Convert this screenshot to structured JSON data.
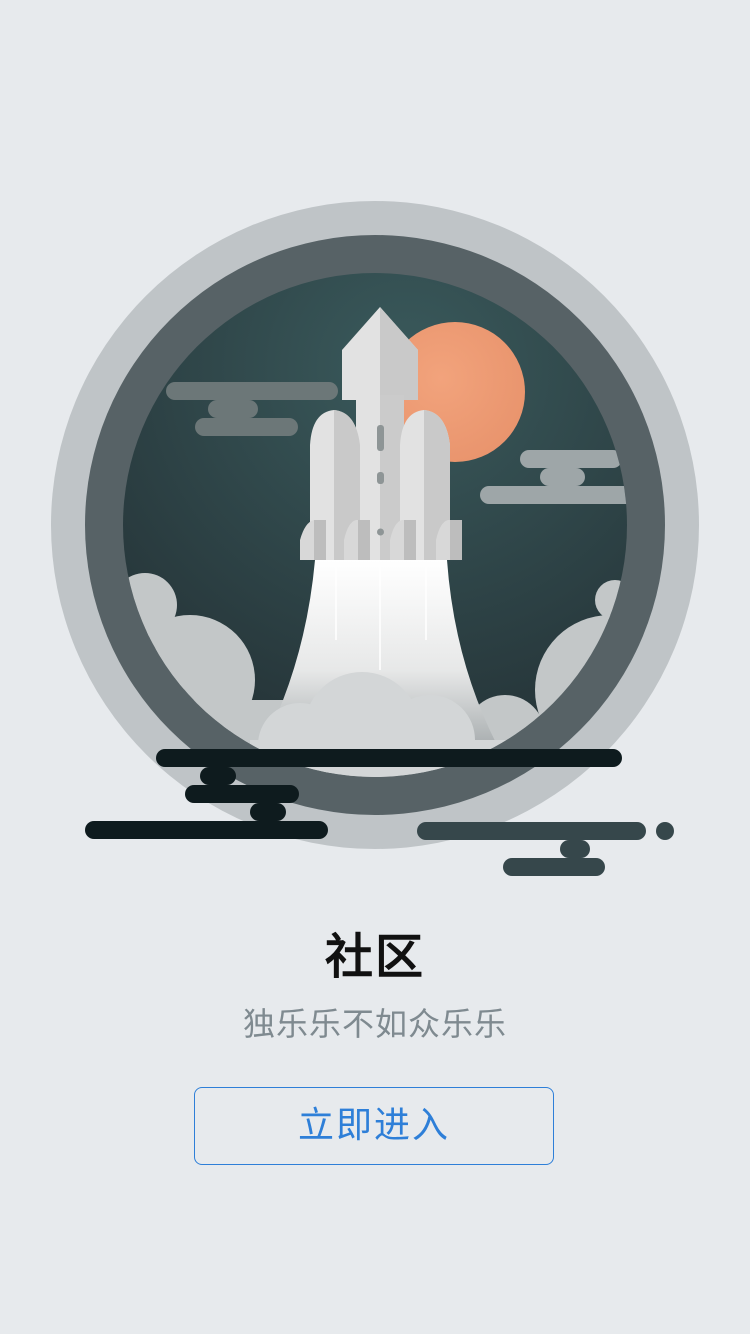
{
  "intro": {
    "title": "社区",
    "subtitle": "独乐乐不如众乐乐",
    "enter_button_label": "立即进入"
  },
  "illustration": {
    "icon": "rocket-launch-icon"
  },
  "colors": {
    "background": "#E7EAED",
    "accent": "#2E7FD8",
    "title_text": "#111111",
    "subtitle_text": "#7F8A90",
    "sun": "#EE9A73",
    "night_sky": "#263539"
  }
}
